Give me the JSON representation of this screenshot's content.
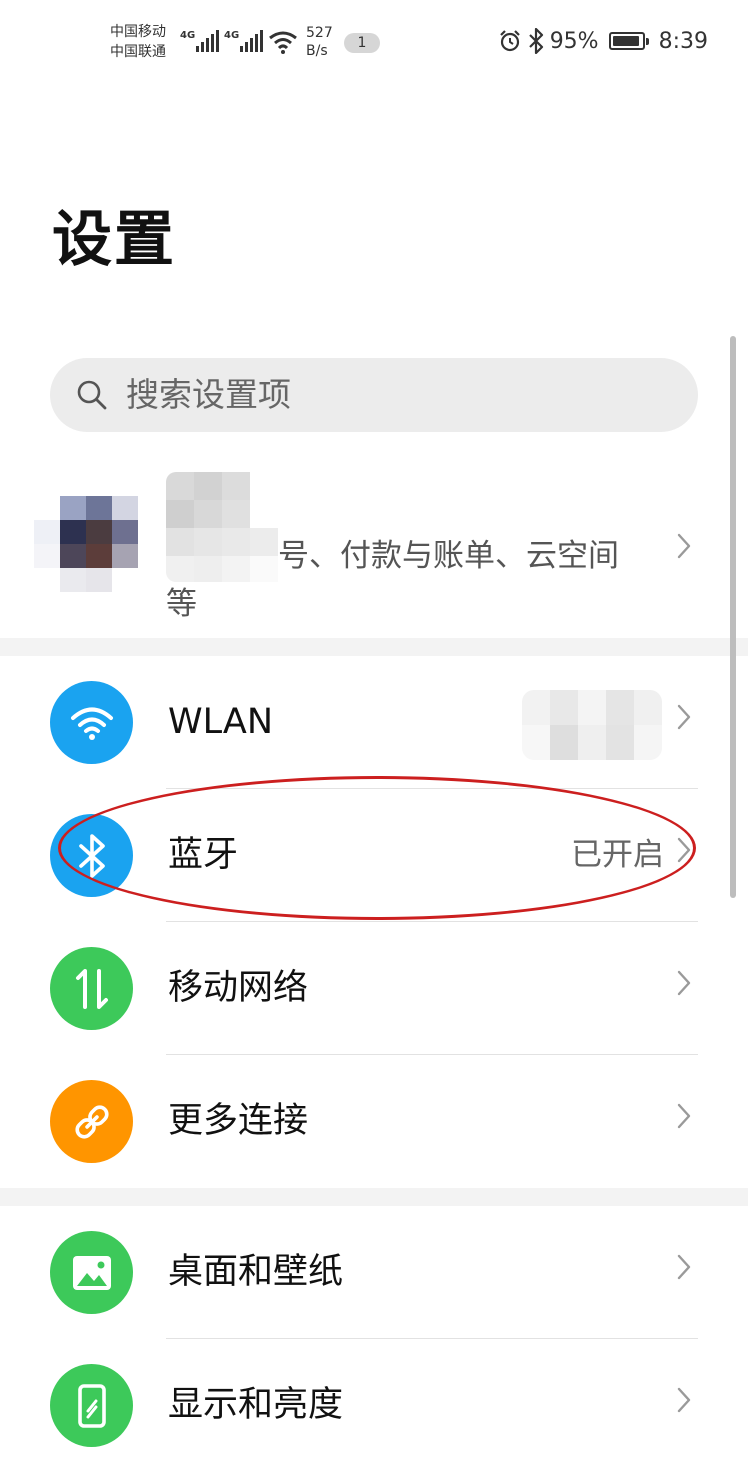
{
  "status_bar": {
    "carrier_1": "中国移动",
    "carrier_2": "中国联通",
    "net_1": "4G",
    "net_2": "4G",
    "speed_value": "527",
    "speed_unit": "B/s",
    "notification_count": "1",
    "battery": "95%",
    "battery_level": 0.95,
    "time": "8:39",
    "icons": [
      "alarm-icon",
      "bluetooth-icon",
      "battery-icon"
    ]
  },
  "header": {
    "title": "设置"
  },
  "search": {
    "placeholder": "搜索设置项"
  },
  "account": {
    "desc_line1": "号、付款与账单、云空间",
    "desc_line2": "等"
  },
  "network_items": [
    {
      "label": "WLAN",
      "value": "",
      "icon": "wifi-icon",
      "color": "#1aa3f0"
    },
    {
      "label": "蓝牙",
      "value": "已开启",
      "icon": "bluetooth-icon",
      "color": "#1aa3f0"
    },
    {
      "label": "移动网络",
      "value": "",
      "icon": "mobile-data-icon",
      "color": "#3dc95a"
    },
    {
      "label": "更多连接",
      "value": "",
      "icon": "link-icon",
      "color": "#ff9500"
    }
  ],
  "display_items": [
    {
      "label": "桌面和壁纸",
      "icon": "wallpaper-icon",
      "color": "#3dc95a"
    },
    {
      "label": "显示和亮度",
      "icon": "display-icon",
      "color": "#3dc95a"
    }
  ],
  "colors": {
    "annotation": "#cc1f1f",
    "section_gap": "#f3f3f3",
    "search_bg": "#ececec"
  }
}
